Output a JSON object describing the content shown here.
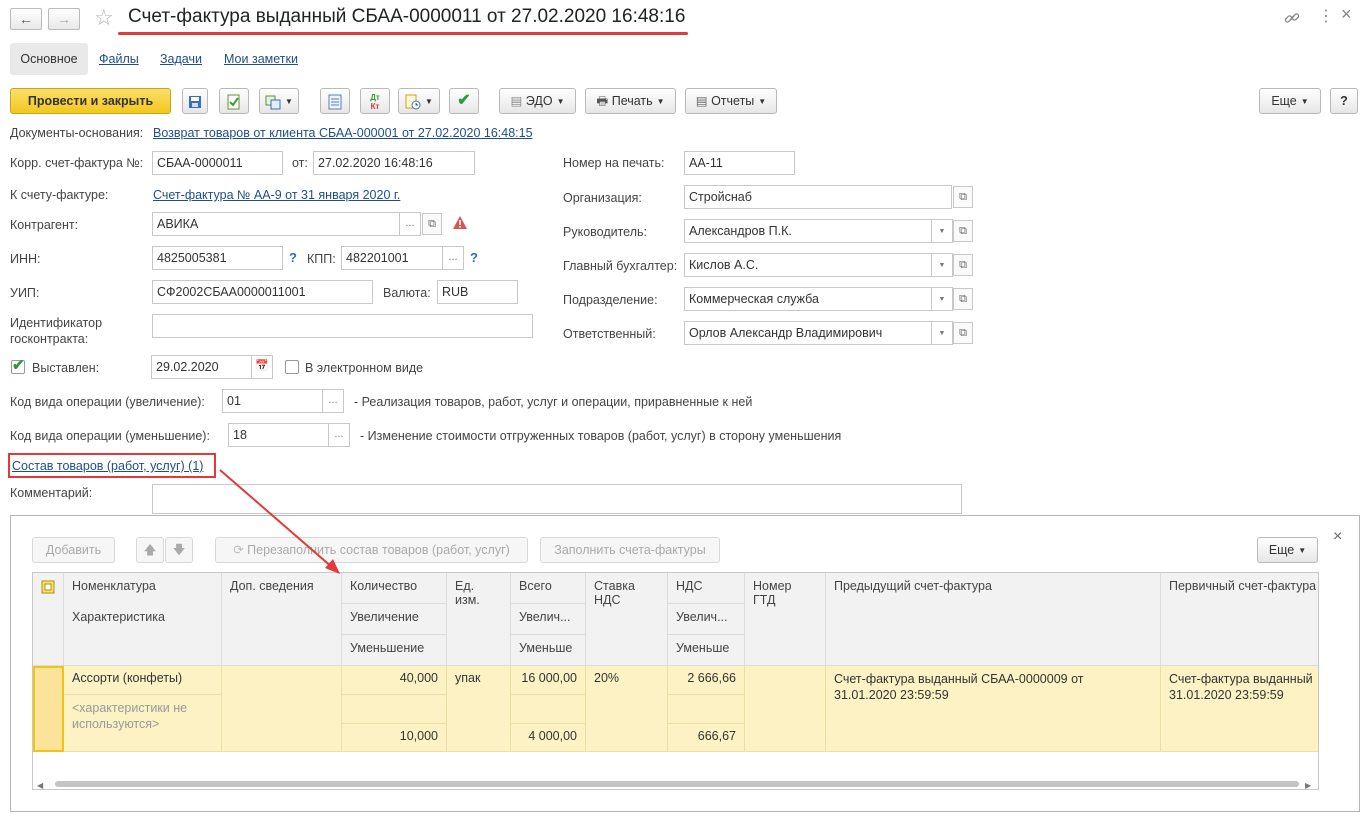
{
  "header": {
    "title": "Счет-фактура выданный СБАА-0000011 от 27.02.2020 16:48:16"
  },
  "tabs": [
    {
      "label": "Основное"
    },
    {
      "label": "Файлы"
    },
    {
      "label": "Задачи"
    },
    {
      "label": "Мои заметки"
    }
  ],
  "toolbar": {
    "post_close": "Провести и закрыть",
    "edo": "ЭДО",
    "print": "Печать",
    "reports": "Отчеты",
    "more": "Еще",
    "help": "?"
  },
  "form": {
    "basis_label": "Документы-основания:",
    "basis_link": "Возврат товаров от клиента СБАА-000001 от 27.02.2020 16:48:15",
    "corr_label": "Корр. счет-фактура №:",
    "corr_number": "СБАА-0000011",
    "from_label": "от:",
    "corr_date": "27.02.2020 16:48:16",
    "to_invoice_label": "К счету-фактуре:",
    "to_invoice_link": "Счет-фактура № АА-9 от 31 января 2020 г.",
    "counterparty_label": "Контрагент:",
    "counterparty": "АВИКА",
    "inn_label": "ИНН:",
    "inn": "4825005381",
    "kpp_label": "КПП:",
    "kpp": "482201001",
    "uip_label": "УИП:",
    "uip": "СФ2002СБАА0000011001",
    "currency_label": "Валюта:",
    "currency": "RUB",
    "contract_id_label_1": "Идентификатор",
    "contract_id_label_2": "госконтракта:",
    "contract_id": "",
    "issued_label": "Выставлен:",
    "issued_date": "29.02.2020",
    "electronic_label": "В электронном виде",
    "op_increase_label": "Код вида операции (увеличение):",
    "op_increase_code": "01",
    "op_increase_desc": "- Реализация товаров, работ, услуг и операции, приравненные к ней",
    "op_decrease_label": "Код вида операции (уменьшение):",
    "op_decrease_code": "18",
    "op_decrease_desc": "- Изменение стоимости отгруженных товаров (работ, услуг) в сторону уменьшения",
    "goods_link": "Состав товаров (работ, услуг) (1)",
    "comment_label": "Комментарий:",
    "comment": "",
    "print_number_label": "Номер на печать:",
    "print_number": "АА-11",
    "org_label": "Организация:",
    "org": "Стройснаб",
    "head_label": "Руководитель:",
    "head": "Александров П.К.",
    "accountant_label": "Главный бухгалтер:",
    "accountant": "Кислов А.С.",
    "dept_label": "Подразделение:",
    "dept": "Коммерческая служба",
    "responsible_label": "Ответственный:",
    "responsible": "Орлов Александр Владимирович"
  },
  "panel": {
    "add": "Добавить",
    "refill": "Перезаполнить состав товаров (работ, услуг)",
    "fill_invoices": "Заполнить счета-фактуры",
    "more": "Еще",
    "close": "×",
    "columns": {
      "nomenclature": "Номенклатура",
      "characteristic": "Характеристика",
      "extra": "Доп. сведения",
      "quantity": "Количество",
      "increase": "Увеличение",
      "decrease": "Уменьшение",
      "unit_1": "Ед.",
      "unit_2": "изм.",
      "total": "Всего",
      "total_inc": "Увелич...",
      "total_dec": "Уменьше",
      "rate_1": "Ставка",
      "rate_2": "НДС",
      "vat": "НДС",
      "vat_inc": "Увелич...",
      "vat_dec": "Уменьше",
      "gtd_1": "Номер",
      "gtd_2": "ГТД",
      "prev_invoice": "Предыдущий счет-фактура",
      "primary_invoice": "Первичный счет-фактура"
    },
    "rows": [
      {
        "nomenclature": "Ассорти (конфеты)",
        "characteristic_1": "<характеристики не",
        "characteristic_2": "используются>",
        "qty_increase": "40,000",
        "qty_decrease": "10,000",
        "unit": "упак",
        "total_increase": "16 000,00",
        "total_decrease": "4 000,00",
        "rate": "20%",
        "vat_increase": "2 666,66",
        "vat_decrease": "666,67",
        "prev_invoice_1": "Счет-фактура выданный СБАА-0000009 от",
        "prev_invoice_2": "31.01.2020 23:59:59",
        "primary_invoice_1": "Счет-фактура выданный",
        "primary_invoice_2": "31.01.2020 23:59:59"
      }
    ]
  }
}
